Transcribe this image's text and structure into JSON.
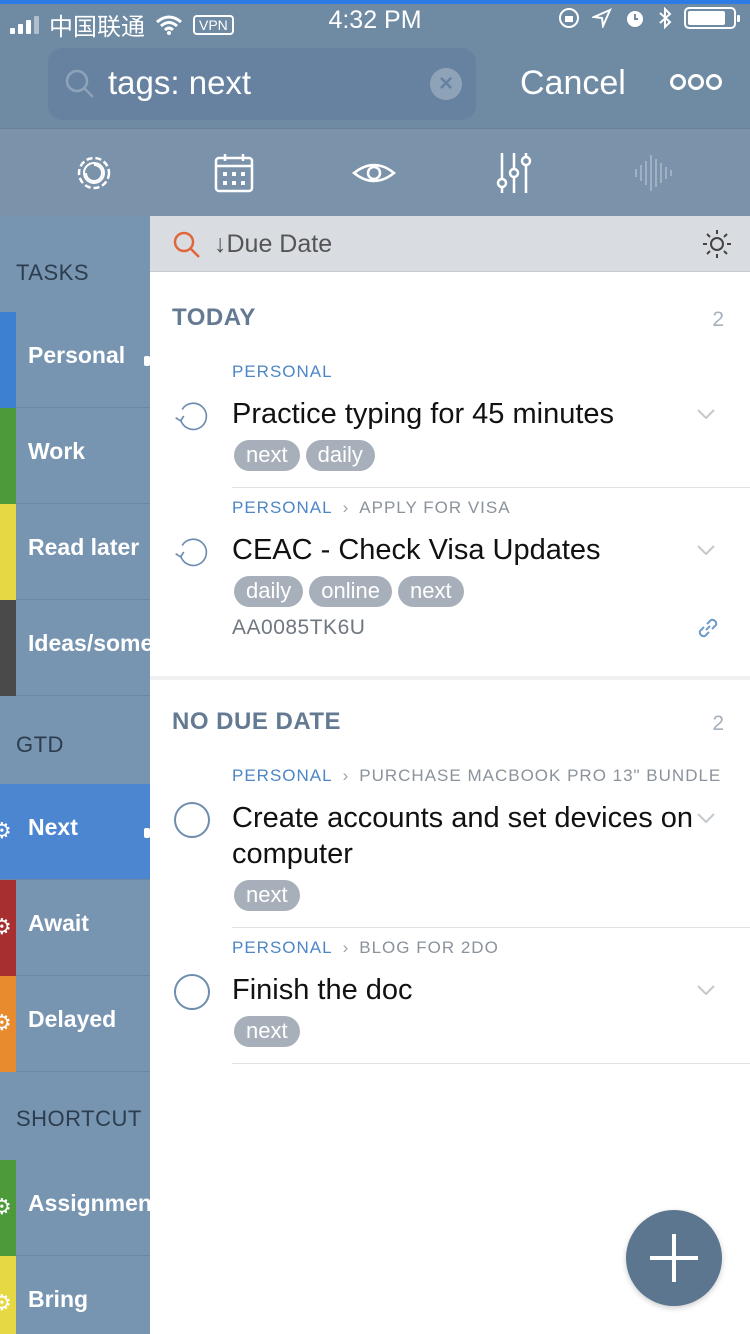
{
  "status_bar": {
    "carrier": "中国联通",
    "vpn": "VPN",
    "time": "4:32 PM"
  },
  "search": {
    "query": "tags: next",
    "cancel_label": "Cancel"
  },
  "toolbar": {
    "icons": [
      "gear-refresh-icon",
      "calendar-icon",
      "eye-icon",
      "sliders-icon",
      "audio-waveform-icon"
    ]
  },
  "sidebar": {
    "sections": [
      {
        "title": "TASKS"
      },
      {
        "title": "GTD"
      },
      {
        "title": "SHORTCUT"
      }
    ],
    "items": [
      {
        "label": "Personal",
        "color": "#3d7fd0"
      },
      {
        "label": "Work",
        "color": "#4d9a3a"
      },
      {
        "label": "Read later",
        "color": "#e6d843"
      },
      {
        "label": "Ideas/something",
        "color": "#4a4a4a"
      },
      {
        "label": "Next",
        "color": "#4c86d1"
      },
      {
        "label": "Await",
        "color": "#a82f2f"
      },
      {
        "label": "Delayed",
        "color": "#e88a2e"
      },
      {
        "label": "Assignments",
        "color": "#4d9a3a"
      },
      {
        "label": "Bring",
        "color": "#e6d843"
      }
    ]
  },
  "main": {
    "sort_label": "↓Due Date",
    "groups": [
      {
        "title": "TODAY",
        "count": "2",
        "tasks": [
          {
            "project": "PERSONAL",
            "parent": "",
            "title": "Practice typing for 45 minutes",
            "tags": [
              "next",
              "daily"
            ],
            "note": ""
          },
          {
            "project": "PERSONAL",
            "parent": "APPLY FOR VISA",
            "title": "CEAC - Check Visa Updates",
            "tags": [
              "daily",
              "online",
              "next"
            ],
            "note": "AA0085TK6U"
          }
        ]
      },
      {
        "title": "NO DUE DATE",
        "count": "2",
        "tasks": [
          {
            "project": "PERSONAL",
            "parent": "PURCHASE MACBOOK PRO 13\" BUNDLE",
            "title": "Create accounts and set devices on computer",
            "tags": [
              "next"
            ],
            "note": ""
          },
          {
            "project": "PERSONAL",
            "parent": "BLOG FOR 2DO",
            "title": "Finish the doc",
            "tags": [
              "next"
            ],
            "note": ""
          }
        ]
      }
    ]
  }
}
